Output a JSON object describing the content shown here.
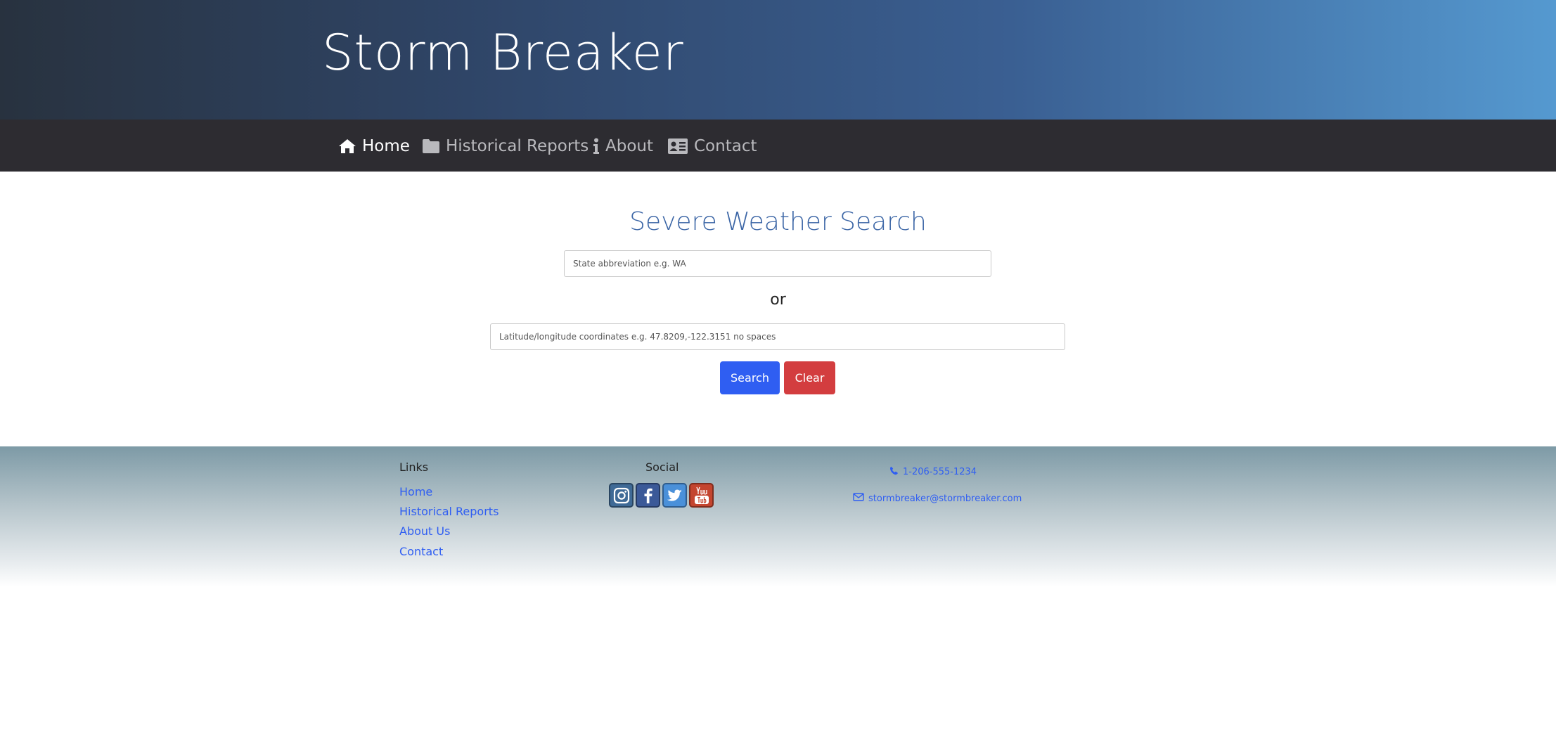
{
  "header": {
    "site_title": "Storm Breaker"
  },
  "nav": {
    "items": [
      {
        "label": "Home",
        "icon": "home-icon",
        "active": true
      },
      {
        "label": "Historical Reports",
        "icon": "folder-icon",
        "active": false
      },
      {
        "label": "About",
        "icon": "info-icon",
        "active": false
      },
      {
        "label": "Contact",
        "icon": "contact-card-icon",
        "active": false
      }
    ]
  },
  "search": {
    "title": "Severe Weather Search",
    "state_placeholder": "State abbreviation e.g. WA",
    "or_label": "or",
    "coords_placeholder": "Latitude/longitude coordinates e.g. 47.8209,-122.3151 no spaces",
    "search_label": "Search",
    "clear_label": "Clear"
  },
  "footer": {
    "links_heading": "Links",
    "links": [
      "Home",
      "Historical Reports",
      "About Us",
      "Contact"
    ],
    "social_heading": "Social",
    "social": [
      {
        "icon": "instagram-icon",
        "color": "#3f6a96"
      },
      {
        "icon": "facebook-icon",
        "color": "#3b5998"
      },
      {
        "icon": "twitter-icon",
        "color": "#4a90d9"
      },
      {
        "icon": "youtube-icon",
        "color": "#c4452f"
      }
    ],
    "phone": "1-206-555-1234",
    "email": "stormbreaker@stormbreaker.com"
  },
  "colors": {
    "accent": "#2f5ef2",
    "danger": "#d33d3f",
    "title": "#3c66a6",
    "navbar": "#2d2c31"
  }
}
